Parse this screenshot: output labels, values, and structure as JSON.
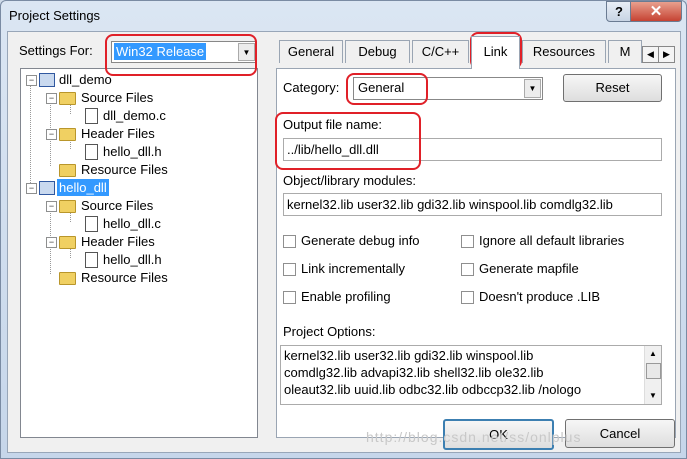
{
  "window": {
    "title": "Project Settings"
  },
  "titlebar": {
    "help": "?",
    "close": "✕"
  },
  "settings_for": {
    "label_pre": "Settings For:",
    "value": "Win32 Release"
  },
  "tree": {
    "dll_demo": "dll_demo",
    "source_files_1": "Source Files",
    "file_dll_demo_c": "dll_demo.c",
    "header_files_1": "Header Files",
    "file_hello_dll_h_1": "hello_dll.h",
    "resource_files_1": "Resource Files",
    "hello_dll": "hello_dll",
    "source_files_2": "Source Files",
    "file_hello_dll_c": "hello_dll.c",
    "header_files_2": "Header Files",
    "file_hello_dll_h_2": "hello_dll.h",
    "resource_files_2": "Resource Files"
  },
  "tabs": [
    "General",
    "Debug",
    "C/C++",
    "Link",
    "Resources",
    "M"
  ],
  "tab_scroll": {
    "left": "◀",
    "right": "▶"
  },
  "category": {
    "label_pre": "Category:",
    "value": "General"
  },
  "reset_button": "Reset",
  "output_file": {
    "label": "Output file name:",
    "value": "../lib/hello_dll.dll"
  },
  "object_modules": {
    "label": "Object/library modules:",
    "value": "kernel32.lib user32.lib gdi32.lib winspool.lib comdlg32.lib"
  },
  "checkboxes": {
    "generate_debug": "Generate debug info",
    "ignore_default": "Ignore all default libraries",
    "link_incrementally": "Link incrementally",
    "generate_mapfile": "Generate mapfile",
    "enable_profiling": "Enable profiling",
    "doesnt_produce_lib": "Doesn't produce .LIB"
  },
  "project_options": {
    "label": "Project Options:",
    "lines": [
      "kernel32.lib user32.lib gdi32.lib winspool.lib",
      "comdlg32.lib advapi32.lib shell32.lib ole32.lib",
      "oleaut32.lib uuid.lib odbc32.lib odbccp32.lib /nologo"
    ]
  },
  "ok_button": "OK",
  "cancel_button": "Cancel",
  "watermark": "http://blog.csdn.net/ss/onlplus"
}
